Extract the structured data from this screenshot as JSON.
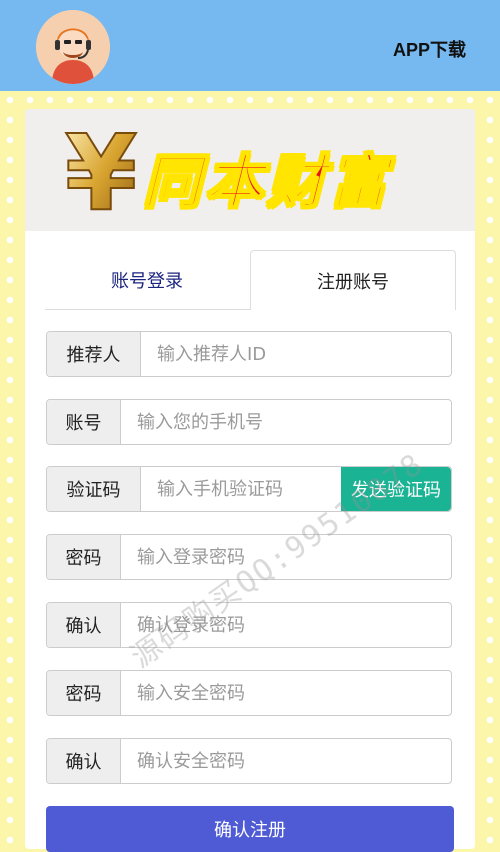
{
  "header": {
    "app_download": "APP下载"
  },
  "logo": {
    "symbol": "¥",
    "text": "同本财富"
  },
  "tabs": [
    {
      "label": "账号登录",
      "active": false
    },
    {
      "label": "注册账号",
      "active": true
    }
  ],
  "form": {
    "referrer": {
      "label": "推荐人",
      "placeholder": "输入推荐人ID",
      "value": ""
    },
    "account": {
      "label": "账号",
      "placeholder": "输入您的手机号",
      "value": ""
    },
    "captcha": {
      "label": "验证码",
      "placeholder": "输入手机验证码",
      "value": "",
      "send_label": "发送验证码"
    },
    "password": {
      "label": "密码",
      "placeholder": "输入登录密码",
      "value": ""
    },
    "confirm": {
      "label": "确认",
      "placeholder": "确认登录密码",
      "value": ""
    },
    "safe_password": {
      "label": "密码",
      "placeholder": "输入安全密码",
      "value": ""
    },
    "safe_confirm": {
      "label": "确认",
      "placeholder": "确认安全密码",
      "value": ""
    },
    "submit_label": "确认注册"
  },
  "watermark": "源码购买QQ:99510878",
  "colors": {
    "header_bg": "#76b8f0",
    "page_bg": "#fbf6a9",
    "send_button": "#1ab394",
    "submit_button": "#4f5bd5",
    "logo_red": "#e8121b",
    "logo_yellow": "#ffe500"
  },
  "icons": {
    "avatar": "customer-service-avatar",
    "logo": "yuan-symbol-logo"
  }
}
